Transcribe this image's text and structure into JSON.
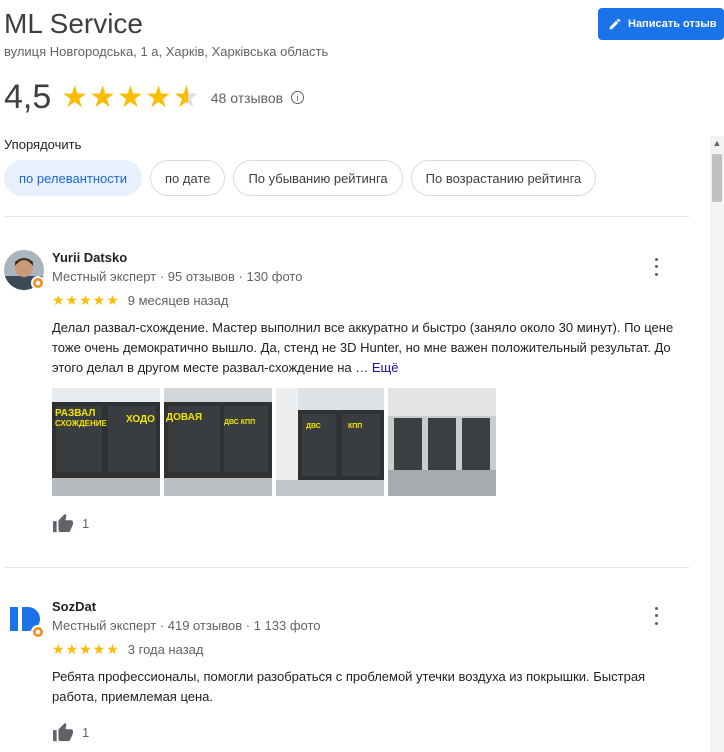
{
  "header": {
    "title": "ML Service",
    "address": "вулиця Новгородська, 1 а, Харків, Харківська область",
    "write_review_label": "Написать отзыв",
    "rating": "4,5",
    "reviews_count": "48 отзывов",
    "star_rating": 4.5
  },
  "sort": {
    "label": "Упорядочить",
    "options": [
      "по релевантности",
      "по дате",
      "По убыванию рейтинга",
      "По возрастанию рейтинга"
    ],
    "active_index": 0
  },
  "reviews": [
    {
      "author": "Yurii Datsko",
      "meta": "Местный эксперт · 95 отзывов · 130 фото",
      "stars": 5,
      "date": "9 месяцев назад",
      "text": "Делал развал-схождение. Мастер выполнил все аккуратно и быстро (заняло около 30 минут). По цене тоже очень демократично вышло. Да, стенд не 3D Hunter, но мне важен положительный результат. До этого делал в другом месте развал-схождение на …",
      "more": "Ещё",
      "likes": "1",
      "photos": [
        {
          "sign1": "РАЗВАЛ",
          "sign2": "СХОЖДЕНИЕ",
          "sign3": "ХОДО"
        },
        {
          "sign1": "ДОВАЯ",
          "sign2": "ДВС  КПП"
        },
        {
          "sign1": "ДВС",
          "sign2": "КПП"
        },
        {
          "sign1": ""
        }
      ]
    },
    {
      "author": "SozDat",
      "meta": "Местный эксперт · 419 отзывов · 1 133 фото",
      "stars": 5,
      "date": "3 года назад",
      "text": "Ребята профессионалы, помогли разобраться с проблемой утечки воздуха из покрышки. Быстрая работа, приемлемая цена.",
      "likes": "1"
    }
  ],
  "colors": {
    "accent": "#1a73e8",
    "star": "#fbbc04",
    "chip_active_bg": "#e8f0fe",
    "chip_active_text": "#1967d2",
    "badge": "#f28b20"
  }
}
